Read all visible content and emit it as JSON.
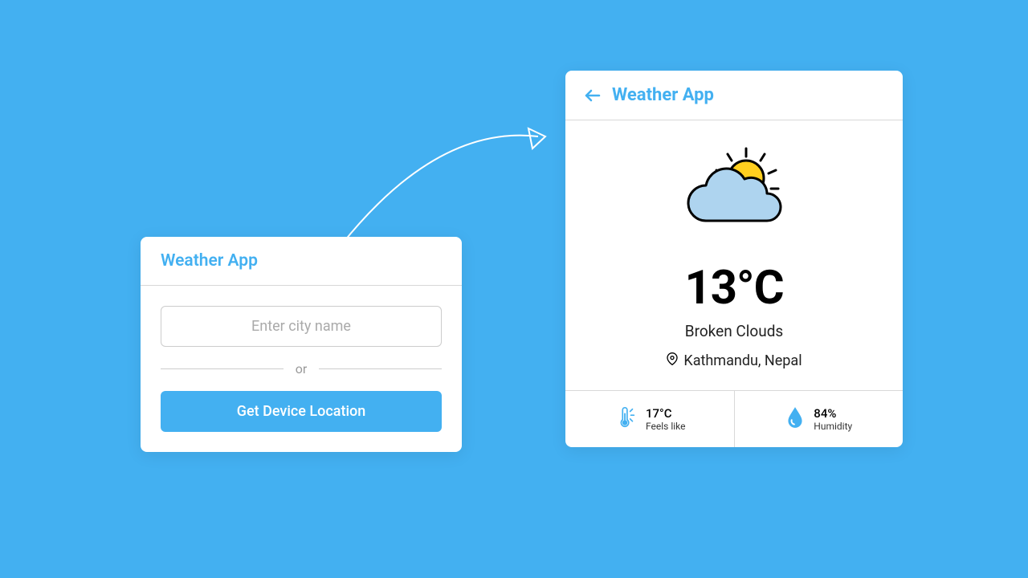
{
  "input_card": {
    "title": "Weather App",
    "city_placeholder": "Enter city name",
    "separator": "or",
    "location_button": "Get Device Location"
  },
  "result_card": {
    "title": "Weather App",
    "temperature": "13°C",
    "condition": "Broken Clouds",
    "location": "Kathmandu, Nepal",
    "feels_like": {
      "value": "17°C",
      "label": "Feels like"
    },
    "humidity": {
      "value": "84%",
      "label": "Humidity"
    }
  }
}
